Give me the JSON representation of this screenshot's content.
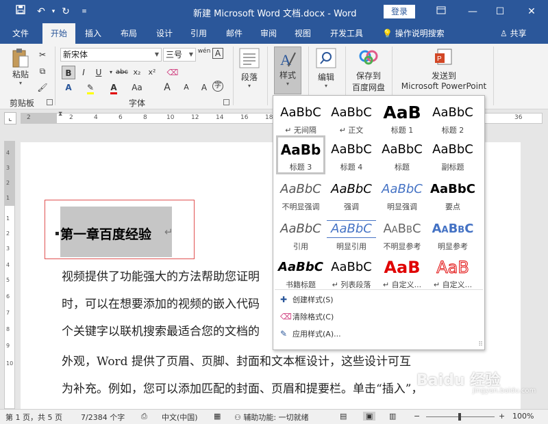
{
  "window": {
    "title": "新建 Microsoft Word 文档.docx  -  Word",
    "login_label": "登录",
    "qa_icons": [
      "save-icon",
      "undo-icon",
      "redo-icon",
      "customize-icon"
    ],
    "window_icons": [
      "ribbon-display-icon",
      "minimize-icon",
      "maximize-icon",
      "close-icon"
    ]
  },
  "tabs": {
    "items": [
      {
        "label": "文件"
      },
      {
        "label": "开始"
      },
      {
        "label": "插入"
      },
      {
        "label": "布局"
      },
      {
        "label": "设计"
      },
      {
        "label": "引用"
      },
      {
        "label": "邮件"
      },
      {
        "label": "审阅"
      },
      {
        "label": "视图"
      },
      {
        "label": "开发工具"
      }
    ],
    "active_index": 1,
    "tell_me": "操作说明搜索",
    "share": "共享"
  },
  "ribbon": {
    "clipboard": {
      "paste_label": "粘贴",
      "group_label": "剪贴板"
    },
    "font": {
      "font_name": "新宋体",
      "font_size": "三号",
      "wen_label": "wén",
      "format_buttons": [
        "B",
        "I",
        "U",
        "abc",
        "x₂",
        "x²"
      ],
      "effect_buttons": [
        "A",
        "A",
        "Aa",
        "A",
        "A"
      ],
      "group_label": "字体"
    },
    "paragraph": {
      "label": "段落"
    },
    "styles": {
      "label": "样式"
    },
    "editing": {
      "label": "编辑"
    },
    "baidu": {
      "label_line1": "保存到",
      "label_line2": "百度网盘"
    },
    "ppt": {
      "label_line1": "发送到",
      "label_line2": "Microsoft PowerPoint"
    }
  },
  "ruler": {
    "h_numbers": [
      "2",
      "2",
      "4",
      "6",
      "8",
      "10",
      "12",
      "14",
      "16",
      "18",
      "20",
      "22",
      "24",
      "26",
      "28",
      "30",
      "32",
      "34",
      "36"
    ],
    "v_numbers": [
      "4",
      "3",
      "2",
      "1",
      "1",
      "2",
      "3",
      "4",
      "5",
      "6",
      "7",
      "8",
      "9",
      "10"
    ]
  },
  "document": {
    "heading": "第一章百度经验",
    "paragraph_mark": "↵",
    "lines": [
      "视频提供了功能强大的方法帮助您证明",
      "时，可以在想要添加的视频的嵌入代码",
      "个关键字以联机搜索最适合您的文档的",
      "外观，Word 提供了页眉、页脚、封面和文本框设计，这些设计可互",
      "为补充。例如，您可以添加匹配的封面、页眉和提要栏。单击“插入”，"
    ]
  },
  "style_gallery": {
    "rows": [
      [
        {
          "sample": "AaBbC",
          "label": "↵ 无间隔"
        },
        {
          "sample": "AaBbC",
          "label": "↵ 正文"
        },
        {
          "sample": "AaB",
          "label": "标题 1"
        },
        {
          "sample": "AaBbC",
          "label": "标题 2"
        }
      ],
      [
        {
          "sample": "AaBb",
          "label": "标题 3"
        },
        {
          "sample": "AaBbC",
          "label": "标题 4"
        },
        {
          "sample": "AaBbC",
          "label": "标题"
        },
        {
          "sample": "AaBbC",
          "label": "副标题"
        }
      ],
      [
        {
          "sample": "AaBbC",
          "label": "不明显强调"
        },
        {
          "sample": "AaBbC",
          "label": "强调"
        },
        {
          "sample": "AaBbC",
          "label": "明显强调"
        },
        {
          "sample": "AaBbC",
          "label": "要点"
        }
      ],
      [
        {
          "sample": "AaBbC",
          "label": "引用"
        },
        {
          "sample": "AaBbC",
          "label": "明显引用"
        },
        {
          "sample": "AaBbC",
          "label": "不明显参考"
        },
        {
          "sample": "AaBbC",
          "label": "明显参考"
        }
      ],
      [
        {
          "sample": "AaBbC",
          "label": "书籍标题"
        },
        {
          "sample": "AaBbC",
          "label": "↵ 列表段落"
        },
        {
          "sample": "AaB",
          "label": "↵ 自定义..."
        },
        {
          "sample": "AaB",
          "label": "↵ 自定义..."
        }
      ]
    ],
    "selected_style": "标题 3",
    "menu": [
      {
        "label": "创建样式(S)",
        "icon": "create-style-icon"
      },
      {
        "label": "清除格式(C)",
        "icon": "clear-format-icon"
      },
      {
        "label": "应用样式(A)...",
        "icon": "apply-style-icon"
      }
    ],
    "colors": {
      "accent_blue": "#4472c4",
      "custom_red": "#e00000"
    }
  },
  "status": {
    "page": "第 1 页，共 5 页",
    "words": "7/2384 个字",
    "language": "中文(中国)",
    "accessibility": "辅助功能: 一切就绪",
    "zoom": "100%",
    "zoom_minus": "−",
    "zoom_plus": "+"
  },
  "watermark": {
    "text": "Baidu 经验",
    "sub": "jingyan.baidu.com"
  }
}
